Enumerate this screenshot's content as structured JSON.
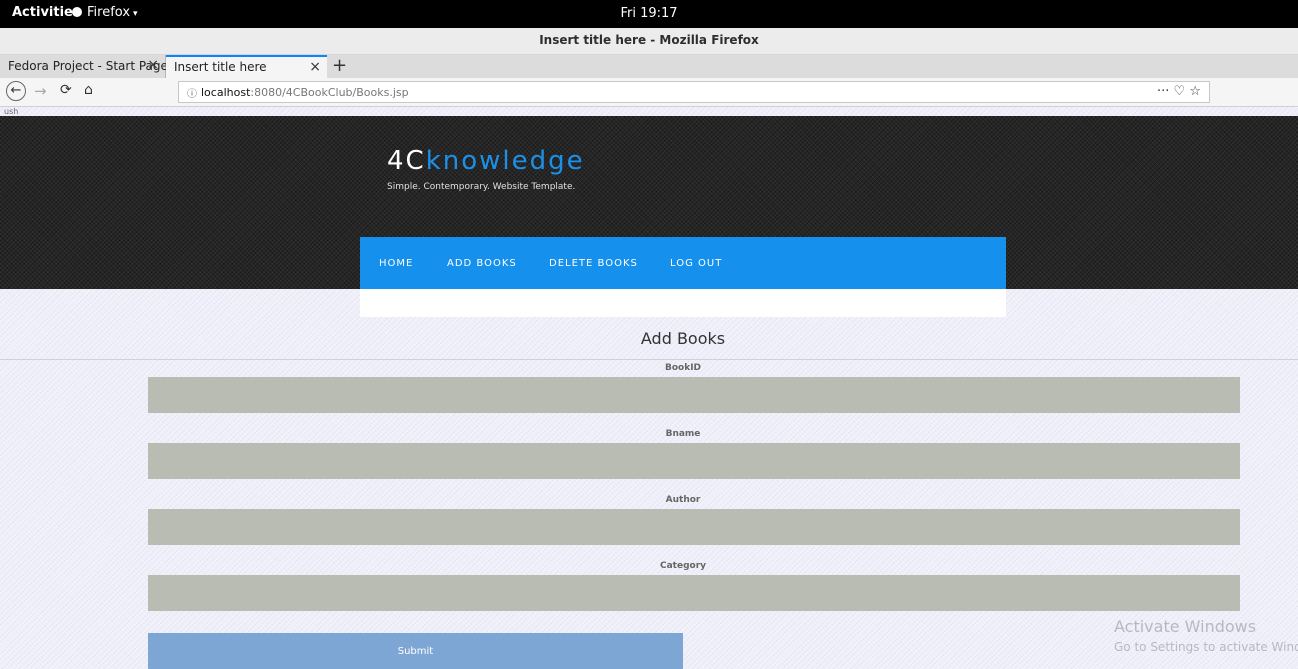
{
  "os_bar": {
    "activities": "Activities",
    "app": "Firefox",
    "app_caret": "▾",
    "clock": "Fri 19:17"
  },
  "window": {
    "title": "Insert title here - Mozilla Firefox"
  },
  "tabs": [
    {
      "label": "Fedora Project - Start Page",
      "close": "×"
    },
    {
      "label": "Insert title here",
      "close": "×"
    }
  ],
  "new_tab": "+",
  "nav": {
    "back": "←",
    "forward": "→",
    "reload": "⟳",
    "home": "⌂",
    "info_icon": "ⓘ",
    "url_host": "localhost",
    "url_path": ":8080/4CBookClub/Books.jsp",
    "right_icons": "··· ♡ ☆"
  },
  "stray_text": "ush",
  "site": {
    "logo_part1": "4C",
    "logo_part2": "knowledge",
    "tagline": "Simple. Contemporary. Website Template.",
    "menu": [
      "HOME",
      "ADD BOOKS",
      "DELETE BOOKS",
      "LOG OUT"
    ],
    "accent_color": "#1590ec",
    "logo_accent_color": "#1b90e8"
  },
  "form": {
    "heading": "Add Books",
    "fields": [
      {
        "label": "BookID",
        "value": ""
      },
      {
        "label": "Bname",
        "value": ""
      },
      {
        "label": "Author",
        "value": ""
      },
      {
        "label": "Category",
        "value": ""
      }
    ],
    "submit": "Submit"
  },
  "watermark": {
    "line1": "Activate Windows",
    "line2": "Go to Settings to activate Windows."
  }
}
